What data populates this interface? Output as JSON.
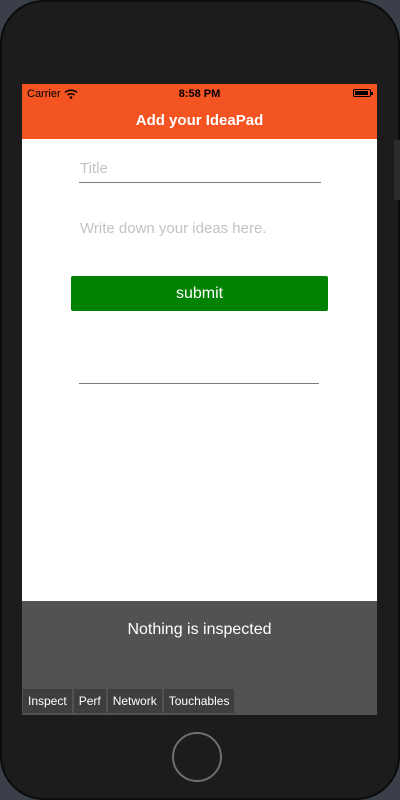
{
  "status_bar": {
    "carrier": "Carrier",
    "time": "8:58 PM",
    "wifi_icon": "wifi-icon",
    "battery_icon": "battery-icon"
  },
  "header": {
    "title": "Add your IdeaPad",
    "background_color": "#f45322"
  },
  "form": {
    "title_placeholder": "Title",
    "title_value": "",
    "idea_placeholder": "Write down your ideas here.",
    "idea_value": "",
    "submit_label": "submit",
    "submit_color": "#028202"
  },
  "inspector": {
    "message": "Nothing is inspected",
    "tabs": [
      {
        "label": "Inspect"
      },
      {
        "label": "Perf"
      },
      {
        "label": "Network"
      },
      {
        "label": "Touchables"
      }
    ]
  }
}
